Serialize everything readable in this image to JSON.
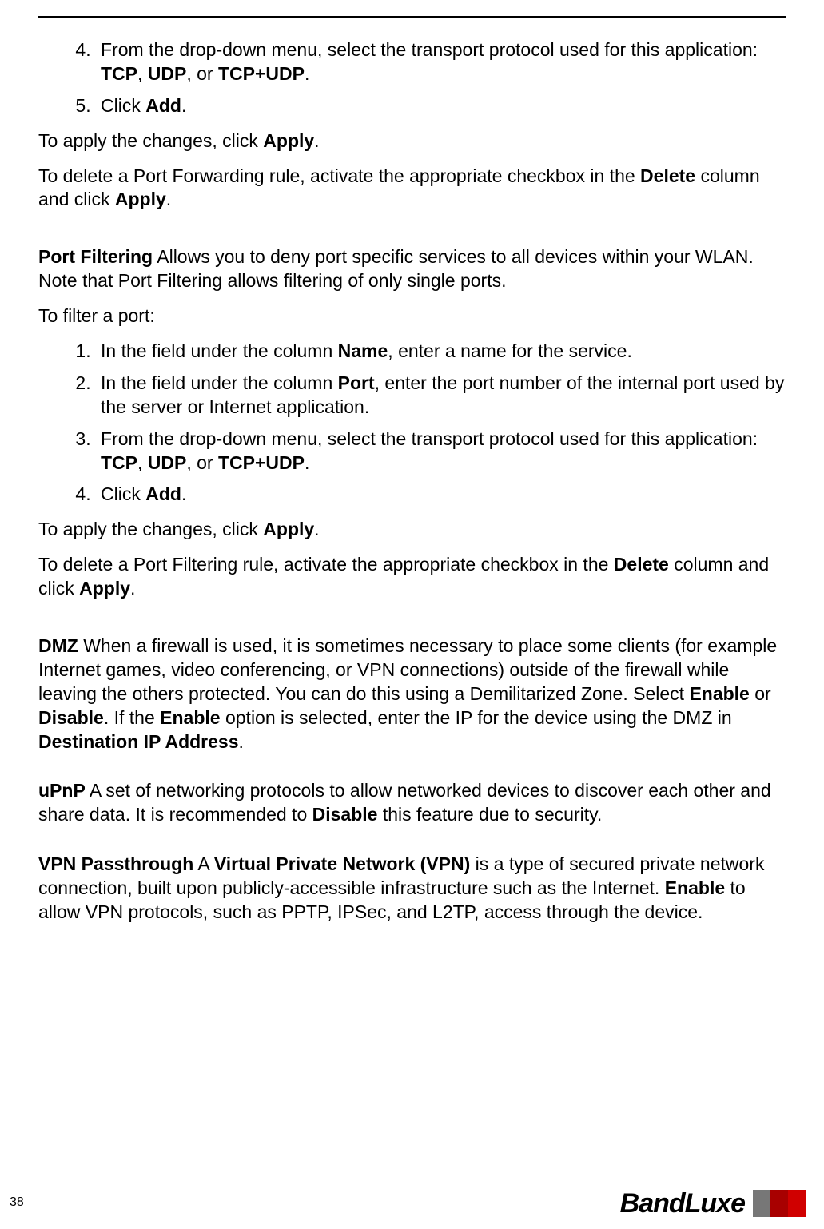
{
  "list_a": {
    "start": 4,
    "items": [
      {
        "pre": "From the drop-down menu, select the transport protocol used for this application: ",
        "b1": "TCP",
        "mid1": ", ",
        "b2": "UDP",
        "mid2": ", or ",
        "b3": "TCP+UDP",
        "post": "."
      },
      {
        "pre": "Click ",
        "b1": "Add",
        "post": "."
      }
    ]
  },
  "apply_a_pre": "To apply the changes, click ",
  "apply_a_b": "Apply",
  "apply_a_post": ".",
  "delete_a_pre": "To delete a Port Forwarding rule, activate the appropriate checkbox in the ",
  "delete_a_b1": "Delete",
  "delete_a_mid": " column and click ",
  "delete_a_b2": "Apply",
  "delete_a_post": ".",
  "pf_title": "Port Filtering",
  "pf_text": " Allows you to deny port specific services to all devices within your WLAN. Note that Port Filtering allows filtering of only single ports.",
  "pf_to": "To filter a port:",
  "list_b": {
    "start": 1,
    "items": [
      {
        "pre": "In the field under the column ",
        "b1": "Name",
        "post": ", enter a name for the service."
      },
      {
        "pre": "In the field under the column ",
        "b1": "Port",
        "post": ", enter the port number of the internal port used by the server or Internet application."
      },
      {
        "pre": "From the drop-down menu, select the transport protocol used for this application: ",
        "b1": "TCP",
        "mid1": ", ",
        "b2": "UDP",
        "mid2": ", or ",
        "b3": "TCP+UDP",
        "post": "."
      },
      {
        "pre": "Click ",
        "b1": "Add",
        "post": "."
      }
    ]
  },
  "apply_b_pre": "To apply the changes, click ",
  "apply_b_b": "Apply",
  "apply_b_post": ".",
  "delete_b_pre": "To delete a Port Filtering rule, activate the appropriate checkbox in the ",
  "delete_b_b1": "Delete",
  "delete_b_mid": " column and click ",
  "delete_b_b2": "Apply",
  "delete_b_post": ".",
  "dmz_title": "DMZ",
  "dmz_t1": " When a firewall is used, it is sometimes necessary to place some clients (for example Internet games, video conferencing, or VPN connections) outside of the firewall while leaving the others protected. You can do this using a Demilitarized Zone. Select ",
  "dmz_b1": "Enable",
  "dmz_t2": " or ",
  "dmz_b2": "Disable",
  "dmz_t3": ". If the ",
  "dmz_b3": "Enable",
  "dmz_t4": " option is selected, enter the IP for the device using the DMZ in ",
  "dmz_b4": "Destination IP Address",
  "dmz_t5": ".",
  "upnp_title": "uPnP",
  "upnp_t1": " A set of networking protocols to allow networked devices to discover each other and share data. It is recommended to ",
  "upnp_b1": "Disable",
  "upnp_t2": " this feature due to security.",
  "vpn_title": "VPN Passthrough",
  "vpn_t1": " A ",
  "vpn_b1": "Virtual Private Network (VPN)",
  "vpn_t2": " is a type of secured private network connection, built upon publicly-accessible infrastructure such as the Internet. ",
  "vpn_b2": "Enable",
  "vpn_t3": " to allow VPN protocols, such as PPTP, IPSec, and L2TP, access through the device.",
  "page_number": "38",
  "brand": "BandLuxe"
}
